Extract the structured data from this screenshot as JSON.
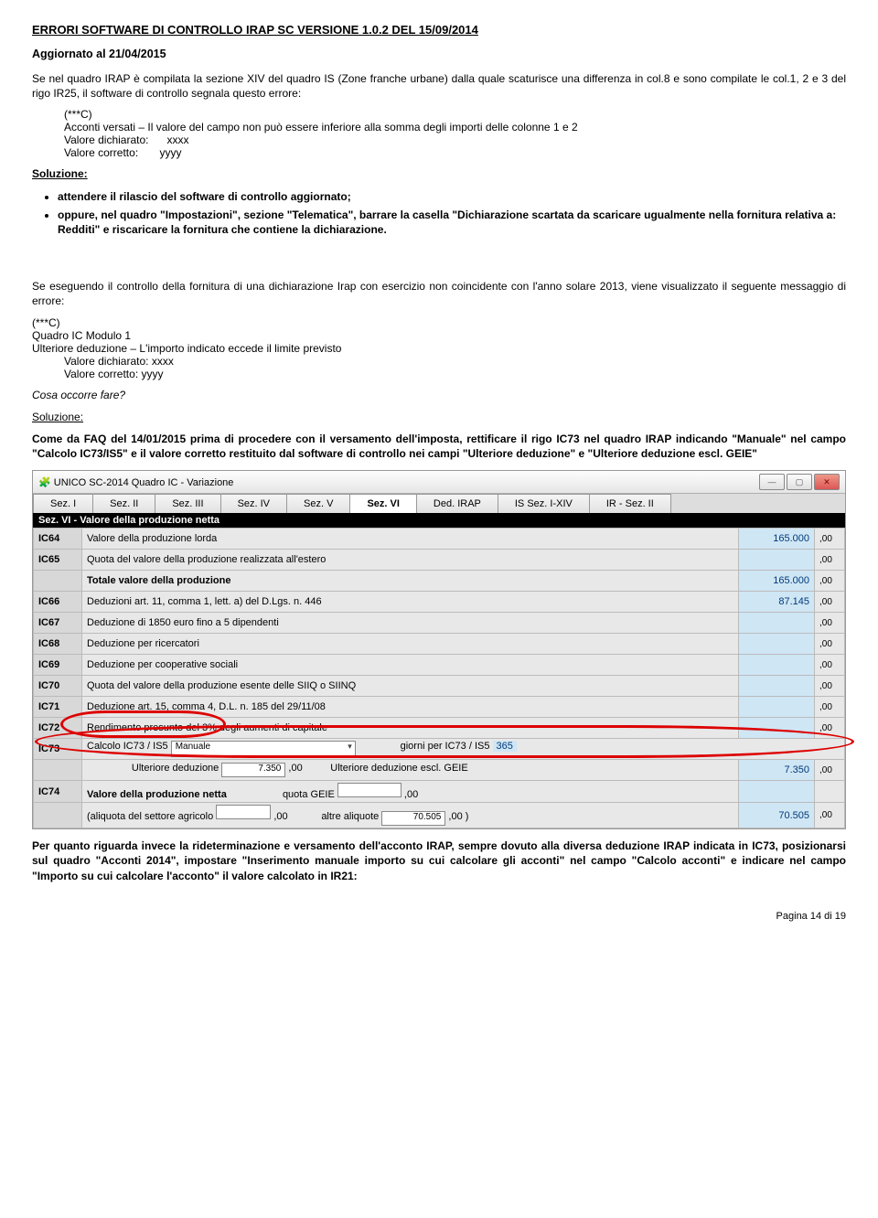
{
  "header": {
    "title": "ERRORI SOFTWARE DI CONTROLLO IRAP SC VERSIONE 1.0.2 DEL 15/09/2014",
    "updated": "Aggiornato al 21/04/2015"
  },
  "intro1": "Se nel quadro IRAP è compilata la sezione XIV del quadro IS (Zone franche urbane) dalla quale scaturisce una differenza in col.8 e sono compilate le col.1, 2 e 3 del rigo IR25, il software di controllo segnala questo errore:",
  "block1": {
    "tag": "(***C)",
    "line1": "Acconti versati – Il valore del campo non può essere inferiore alla somma degli importi delle colonne 1 e 2",
    "vd_label": "Valore dichiarato:",
    "vd_val": "xxxx",
    "vc_label": "Valore corretto:",
    "vc_val": "yyyy"
  },
  "soluzione_label": "Soluzione:",
  "bullets1": [
    "attendere il rilascio del software di controllo aggiornato;",
    "oppure, nel quadro \"Impostazioni\", sezione \"Telematica\", barrare la casella \"Dichiarazione scartata da scaricare ugualmente nella fornitura relativa a: Redditi\" e riscaricare la fornitura che contiene la dichiarazione."
  ],
  "intro2": "Se eseguendo il controllo della fornitura di una dichiarazione Irap con esercizio non coincidente con l'anno solare 2013, viene visualizzato il seguente messaggio di errore:",
  "block2": {
    "tag": "(***C)",
    "line1": "Quadro IC Modulo 1",
    "line2": "Ulteriore deduzione – L'importo indicato eccede il limite previsto",
    "vd": "Valore dichiarato: xxxx",
    "vc": "Valore corretto: yyyy"
  },
  "cosa": "Cosa occorre fare?",
  "sol2": "Come da FAQ del 14/01/2015 prima di procedere con il versamento dell'imposta, rettificare il rigo IC73 nel quadro IRAP indicando \"Manuale\" nel campo \"Calcolo IC73/IS5\" e il valore corretto restituito dal software di controllo nei campi \"Ulteriore deduzione\" e \"Ulteriore deduzione escl. GEIE\"",
  "win_title": "UNICO SC-2014 Quadro IC - Variazione",
  "tabs": [
    "Sez. I",
    "Sez. II",
    "Sez. III",
    "Sez. IV",
    "Sez. V",
    "Sez. VI",
    "Ded. IRAP",
    "IS Sez. I-XIV",
    "IR - Sez. II"
  ],
  "tab_active": 5,
  "section_header": "Sez. VI - Valore della produzione netta",
  "rows": [
    {
      "code": "IC64",
      "label": "Valore della produzione lorda",
      "v": "165.000",
      "d": ",00"
    },
    {
      "code": "IC65",
      "label": "Quota del valore della produzione realizzata all'estero",
      "v": "",
      "d": ",00"
    },
    {
      "code": "",
      "label": "Totale valore della produzione",
      "bold": true,
      "v": "165.000",
      "d": ",00"
    },
    {
      "code": "IC66",
      "label": "Deduzioni art. 11, comma 1, lett. a) del D.Lgs. n. 446",
      "v": "87.145",
      "d": ",00"
    },
    {
      "code": "IC67",
      "label": "Deduzione di 1850 euro fino a 5 dipendenti",
      "v": "",
      "d": ",00"
    },
    {
      "code": "IC68",
      "label": "Deduzione per ricercatori",
      "v": "",
      "d": ",00"
    },
    {
      "code": "IC69",
      "label": "Deduzione per cooperative sociali",
      "v": "",
      "d": ",00"
    },
    {
      "code": "IC70",
      "label": "Quota del valore della produzione esente delle SIIQ o SIINQ",
      "v": "",
      "d": ",00"
    },
    {
      "code": "IC71",
      "label": "Deduzione art. 15, comma 4, D.L. n. 185 del 29/11/08",
      "v": "",
      "d": ",00"
    },
    {
      "code": "IC72",
      "label": "Rendimento presunto del 3% degli aumenti di capitale",
      "v": "",
      "d": ",00"
    }
  ],
  "ic73": {
    "code": "IC73",
    "calc_label": "Calcolo IC73 / IS5",
    "calc_value": "Manuale",
    "giorni_label": "giorni per IC73 / IS5",
    "giorni_value": "365",
    "ult_ded_label": "Ulteriore deduzione",
    "ult_ded_val": "7.350",
    "ult_ded_escl_label": "Ulteriore deduzione escl. GEIE",
    "ult_ded_escl_val": "7.350"
  },
  "ic74": {
    "code": "IC74",
    "label": "Valore della produzione netta",
    "aliq_agr_label": "(aliquota del settore agricolo",
    "aliq_agr_val": ",00",
    "quota_geie": "quota GEIE",
    "quota_geie_val": ",00",
    "altre_label": "altre aliquote",
    "altre_val": "70.505",
    "altre_dec": ",00",
    "paren": ")",
    "final_val": "70.505",
    "final_dec": ",00"
  },
  "final_para": "Per quanto riguarda invece la rideterminazione e versamento dell'acconto IRAP, sempre dovuto alla diversa deduzione IRAP indicata in IC73, posizionarsi sul quadro \"Acconti 2014\", impostare \"Inserimento manuale importo su cui calcolare gli acconti\" nel campo \"Calcolo acconti\" e indicare nel campo \"Importo su cui calcolare l'acconto\" il valore calcolato in IR21:",
  "footer": "Pagina 14 di 19"
}
